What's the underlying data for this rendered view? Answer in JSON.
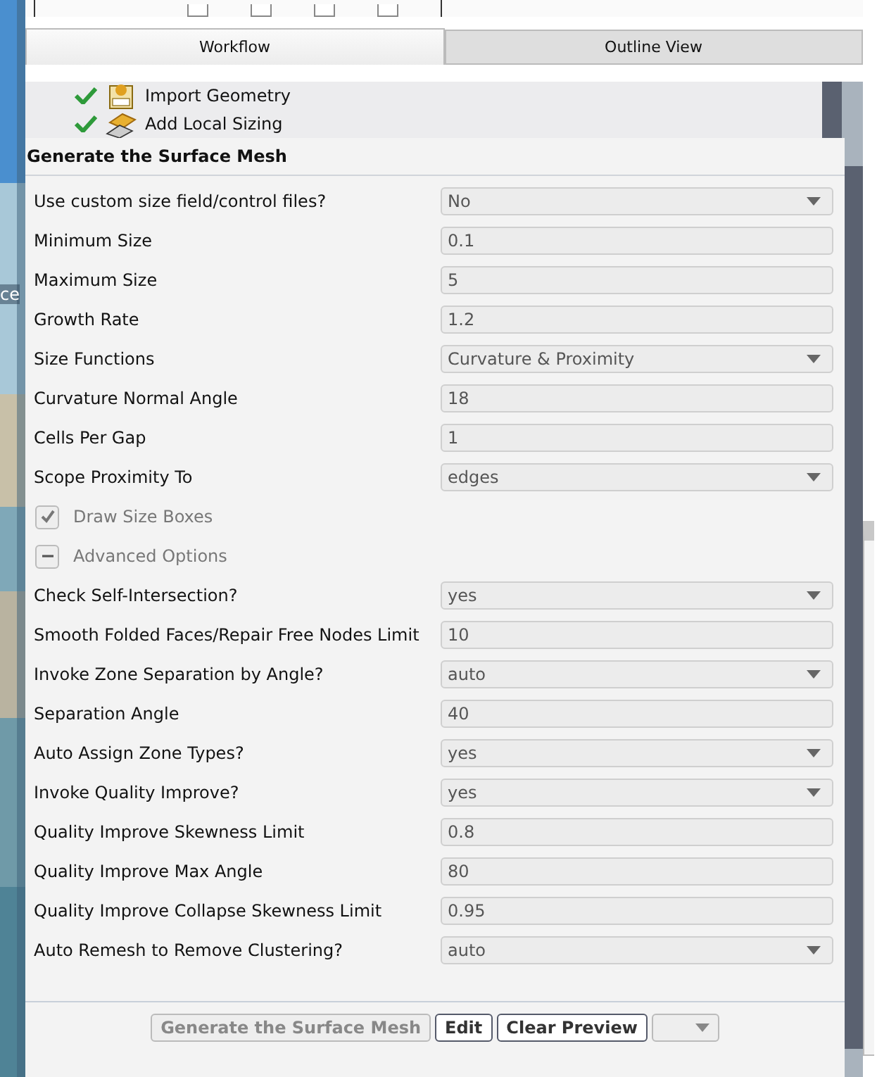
{
  "desktop_label": "ce",
  "toolbar": {
    "checkboxes": [
      {
        "checked": false
      },
      {
        "checked": false
      },
      {
        "checked": false
      },
      {
        "checked": false
      }
    ]
  },
  "tabs": [
    {
      "label": "Workflow",
      "selected": true
    },
    {
      "label": "Outline View",
      "selected": false
    }
  ],
  "workflow_tree": [
    {
      "label": "Import Geometry",
      "done": true
    },
    {
      "label": "Add Local Sizing",
      "done": true
    }
  ],
  "task": {
    "title": "Generate the Surface Mesh",
    "rows": [
      {
        "kind": "dropdown",
        "label": "Use custom size field/control files?",
        "value": "No"
      },
      {
        "kind": "text",
        "label": "Minimum Size",
        "value": "0.1"
      },
      {
        "kind": "text",
        "label": "Maximum Size",
        "value": "5"
      },
      {
        "kind": "text",
        "label": "Growth Rate",
        "value": "1.2"
      },
      {
        "kind": "dropdown",
        "label": "Size Functions",
        "value": "Curvature & Proximity"
      },
      {
        "kind": "text",
        "label": "Curvature Normal Angle",
        "value": "18"
      },
      {
        "kind": "text",
        "label": "Cells Per Gap",
        "value": "1"
      },
      {
        "kind": "dropdown",
        "label": "Scope Proximity To",
        "value": "edges"
      },
      {
        "kind": "checkbox",
        "label": "Draw Size Boxes",
        "checked": true,
        "disabled": true
      },
      {
        "kind": "group",
        "label": "Advanced Options",
        "expanded": true
      },
      {
        "kind": "dropdown",
        "label": "Check Self-Intersection?",
        "value": "yes"
      },
      {
        "kind": "text",
        "label": "Smooth Folded Faces/Repair Free Nodes Limit",
        "value": "10"
      },
      {
        "kind": "dropdown",
        "label": "Invoke Zone Separation by Angle?",
        "value": "auto"
      },
      {
        "kind": "text",
        "label": "Separation Angle",
        "value": "40"
      },
      {
        "kind": "dropdown",
        "label": "Auto Assign Zone Types?",
        "value": "yes"
      },
      {
        "kind": "dropdown",
        "label": "Invoke Quality Improve?",
        "value": "yes"
      },
      {
        "kind": "text",
        "label": "Quality Improve Skewness Limit",
        "value": "0.8"
      },
      {
        "kind": "text",
        "label": "Quality Improve Max Angle",
        "value": "80"
      },
      {
        "kind": "text",
        "label": "Quality Improve Collapse Skewness Limit",
        "value": "0.95"
      },
      {
        "kind": "dropdown",
        "label": "Auto Remesh to Remove Clustering?",
        "value": "auto"
      }
    ]
  },
  "buttons": [
    {
      "kind": "button",
      "label": "Generate the Surface Mesh",
      "disabled": true
    },
    {
      "kind": "button",
      "label": "Edit",
      "disabled": false
    },
    {
      "kind": "button",
      "label": "Clear Preview",
      "disabled": false
    },
    {
      "kind": "menu",
      "disabled": true
    }
  ]
}
